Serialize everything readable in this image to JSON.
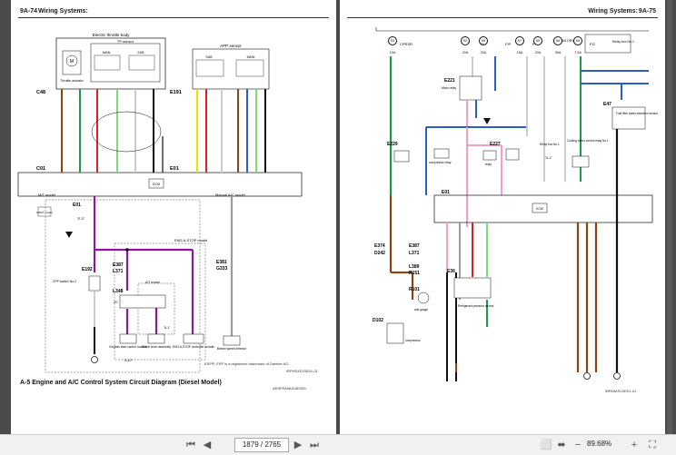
{
  "left_page": {
    "header_left": "9A-74",
    "header_right": "Wiring Systems:",
    "title": "A-5 Engine and A/C Control System Circuit Diagram (Diesel Model)",
    "ref_code": "AENFPA5A513E009",
    "footnote": "ESP®: ESP is a registered trademark of Daimler AG.",
    "image_code": "IRPHS4S1SE01-01",
    "labels": {
      "etb": "Electric throttle body",
      "tp_sensor": "TP sensor",
      "main": "MAIN",
      "sub": "SUB",
      "actuator": "Throttle actuator",
      "app_sensor": "APP sensor",
      "c48": "C48",
      "c01": "C01",
      "e191": "E191",
      "e01": "E01",
      "ecm": "ECM",
      "mt_model": "M/T model",
      "manual_ac": "Manual A/C model",
      "eng_astop": "ENG A-STOP model",
      "at_model": "A/T model",
      "e192": "E192",
      "e387": "E387",
      "l371": "L371",
      "l348": "L348",
      "e381": "E381",
      "g333": "G333",
      "cpp_switch": "CPP switch No.2",
      "jc": "J/C",
      "keyless": "Keyless start control module",
      "select_lever": "Select lever assembly",
      "eng_astop_module": "ENG A-STOP controller module",
      "blower": "Blower speed selector",
      "ref_a1": "\"A-1\"",
      "ref_a10": "\"A-10\"",
      "ref_e3": "\"E-3\"",
      "esp_box": "ESP® model"
    }
  },
  "right_page": {
    "header_left": "Wiring Systems:",
    "header_right": "9A-75",
    "image_code": "IBPA5AS1SE01-01",
    "labels": {
      "e221": "E221",
      "main_relay": "Main relay",
      "e229": "E229",
      "e227": "E227",
      "compressor_relay": "compressor relay",
      "relay": "relay",
      "relay_box": "Relay box No.1",
      "cooling_fan": "Cooling motor control relay No.1",
      "e47": "E47",
      "fuel_filter": "Fuel filter water detection sensor",
      "e01": "E01",
      "ecm": "ECM",
      "e374": "E374",
      "d242": "D242",
      "e387": "E387",
      "l371": "L371",
      "l389": "L389",
      "r151": "R151",
      "r101": "R101",
      "e36": "E36",
      "d102": "D102",
      "refrig_sensor": "Refrigerant pressure sensor",
      "gauge": "and gauge",
      "compressor": "compressor",
      "cprsr": "CPRSR",
      "fi": "FI",
      "fp": "F/P",
      "fi2": "FI2",
      "inj_drv": "INJ DRV",
      "ref_a1": "\"A-1\""
    },
    "fuses": [
      {
        "num": "53",
        "amp": "10A"
      },
      {
        "num": "52",
        "amp": "20A"
      },
      {
        "num": "55",
        "amp": "20A"
      },
      {
        "num": "57",
        "amp": "15A"
      },
      {
        "num": "60",
        "amp": "20A"
      },
      {
        "num": "58",
        "amp": "30A"
      },
      {
        "num": "59",
        "amp": "7.5A"
      }
    ]
  },
  "viewer": {
    "page_value": "1879 / 2765",
    "zoom": "89.68%"
  },
  "colors": {
    "brown": "#8b4513",
    "red": "#e02020",
    "green": "#1a9a4a",
    "lt_green": "#7dd87d",
    "black": "#111111",
    "blue": "#2b5cc8",
    "yellow": "#f0e000",
    "purple": "#8b1a9a",
    "pink": "#f2a0c8",
    "grey": "#9a9a9a",
    "white_wire": "#cccccc"
  }
}
